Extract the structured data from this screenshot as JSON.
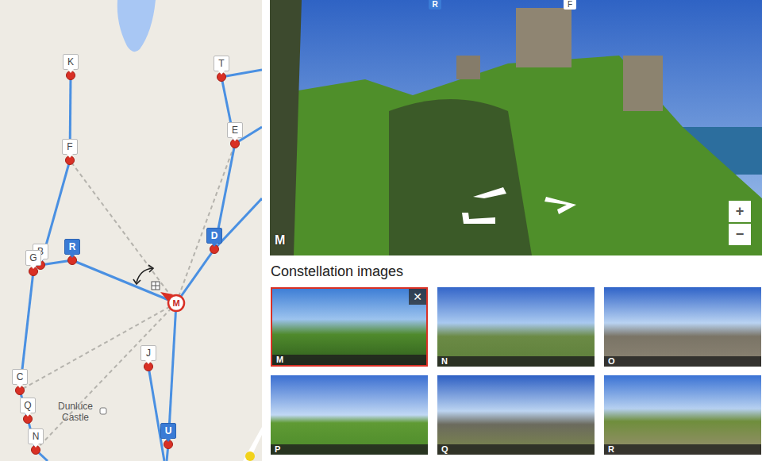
{
  "map": {
    "nodes": [
      {
        "label": "K",
        "selected": false,
        "current": false
      },
      {
        "label": "T",
        "selected": false,
        "current": false
      },
      {
        "label": "E",
        "selected": false,
        "current": false
      },
      {
        "label": "F",
        "selected": false,
        "current": false
      },
      {
        "label": "B",
        "selected": false,
        "current": false
      },
      {
        "label": "G",
        "selected": false,
        "current": false
      },
      {
        "label": "R",
        "selected": true,
        "current": false
      },
      {
        "label": "D",
        "selected": true,
        "current": false
      },
      {
        "label": "M",
        "selected": false,
        "current": true
      },
      {
        "label": "J",
        "selected": false,
        "current": false
      },
      {
        "label": "C",
        "selected": false,
        "current": false
      },
      {
        "label": "Q",
        "selected": false,
        "current": false
      },
      {
        "label": "N",
        "selected": false,
        "current": false
      },
      {
        "label": "U",
        "selected": true,
        "current": false
      }
    ],
    "landmark": "Dunluce Castle"
  },
  "viewer": {
    "label": "M",
    "markers": [
      {
        "label": "R",
        "selected": true
      },
      {
        "label": "F",
        "selected": false
      }
    ],
    "zoom_in": "+",
    "zoom_out": "−"
  },
  "constellation": {
    "title": "Constellation images",
    "close": "✕",
    "images": [
      {
        "label": "M",
        "selected": true
      },
      {
        "label": "N",
        "selected": false
      },
      {
        "label": "O",
        "selected": false
      },
      {
        "label": "P",
        "selected": false
      },
      {
        "label": "Q",
        "selected": false
      },
      {
        "label": "R",
        "selected": false
      }
    ]
  }
}
